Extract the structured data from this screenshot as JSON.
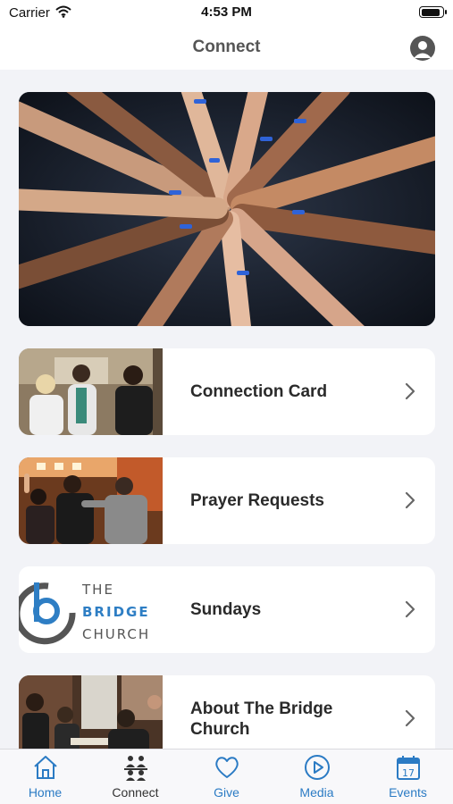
{
  "status_bar": {
    "carrier": "Carrier",
    "time": "4:53 PM",
    "battery_level": 0.95
  },
  "header": {
    "title": "Connect",
    "profile_icon": "person-circle-icon"
  },
  "hero": {
    "image": "hands-together-photo"
  },
  "cards": [
    {
      "label": "Connection Card",
      "image": "people-talking-photo",
      "icon": "chevron-right-icon"
    },
    {
      "label": "Prayer Requests",
      "image": "worship-prayer-photo",
      "icon": "chevron-right-icon"
    },
    {
      "label": "Sundays",
      "image": "bridge-church-logo",
      "logo_text": [
        "THE",
        "BRIDGE",
        "CHURCH"
      ],
      "icon": "chevron-right-icon"
    },
    {
      "label": "About The Bridge Church",
      "image": "church-meeting-photo",
      "icon": "chevron-right-icon"
    }
  ],
  "tab_bar": {
    "active_color": "#2b7bc4",
    "inactive_color": "#333333",
    "selected": "Connect",
    "tabs": [
      {
        "label": "Home",
        "icon": "home-icon"
      },
      {
        "label": "Connect",
        "icon": "connect-people-icon"
      },
      {
        "label": "Give",
        "icon": "heart-icon"
      },
      {
        "label": "Media",
        "icon": "play-circle-icon"
      },
      {
        "label": "Events",
        "icon": "calendar-icon",
        "day": "17"
      }
    ]
  }
}
